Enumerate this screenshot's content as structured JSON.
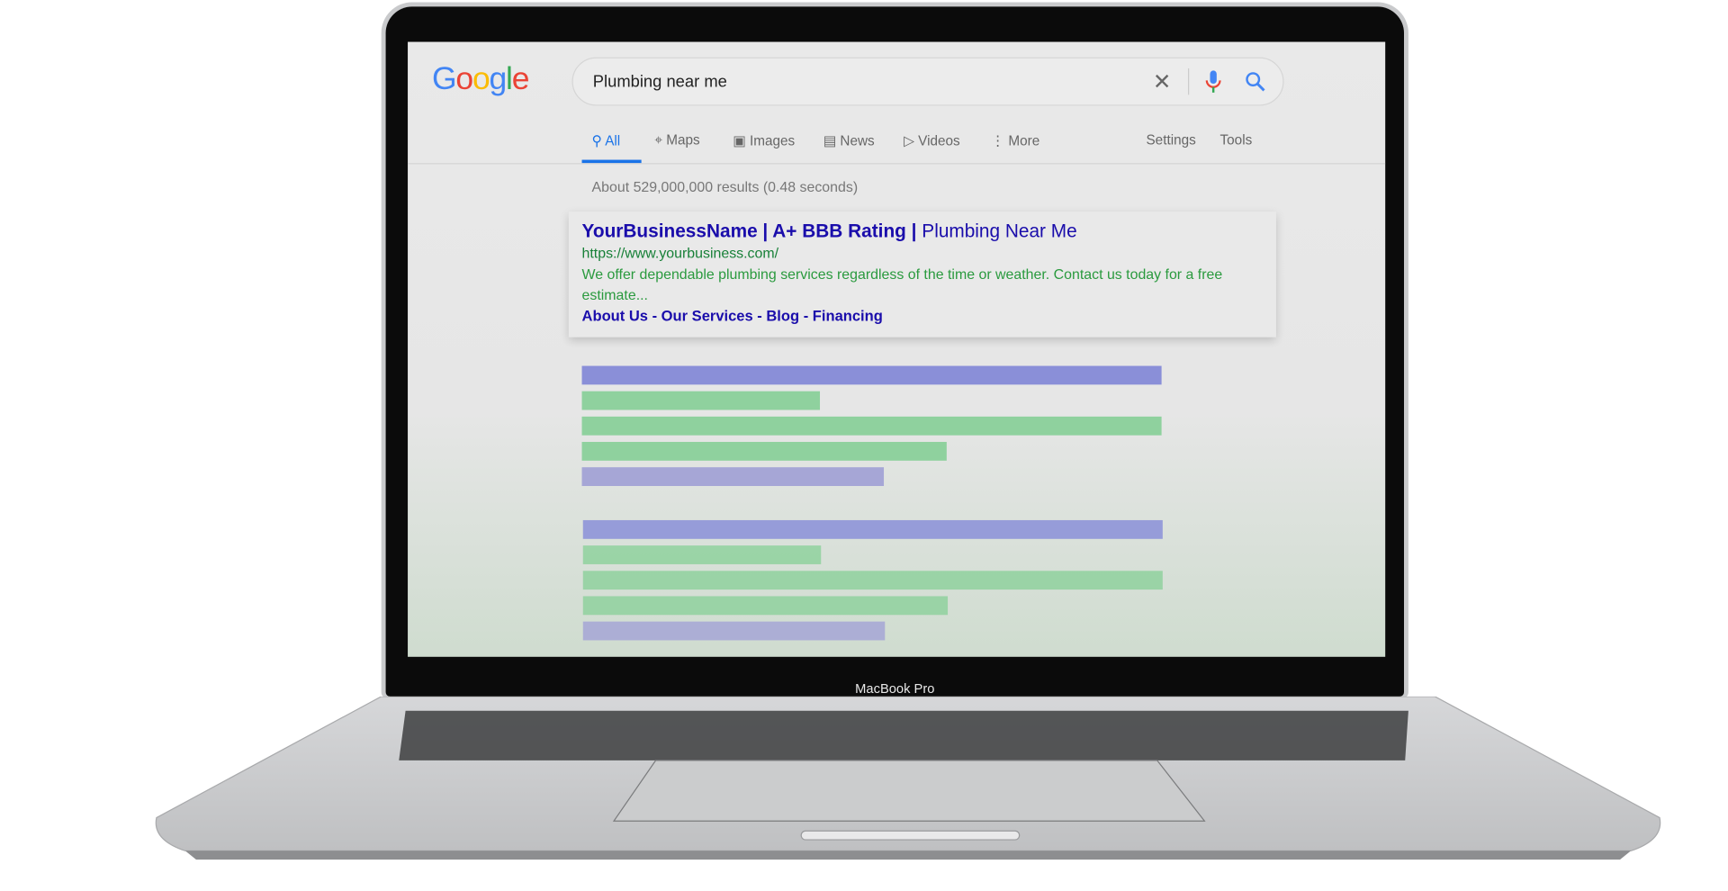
{
  "device": {
    "label": "MacBook Pro"
  },
  "google": {
    "logo": "Google",
    "search_query": "Plumbing near me",
    "icons": {
      "clear": "close-icon",
      "voice": "microphone-icon",
      "search": "search-icon"
    },
    "tabs": [
      {
        "label": "All",
        "icon": "search-icon",
        "active": true
      },
      {
        "label": "Maps",
        "icon": "map-pin-icon"
      },
      {
        "label": "Images",
        "icon": "image-icon"
      },
      {
        "label": "News",
        "icon": "news-icon"
      },
      {
        "label": "Videos",
        "icon": "play-icon"
      },
      {
        "label": "More",
        "icon": "more-vertical-icon"
      }
    ],
    "settings": "Settings",
    "tools": "Tools",
    "stats": "About 529,000,000 results (0.48 seconds)",
    "result": {
      "title": "YourBusinessName | A+ BBB Rating |",
      "title_tail": "Plumbing Near Me",
      "url": "https://www.yourbusiness.com/",
      "description": "We offer dependable plumbing services regardless of the time or weather. Contact us today for a free estimate...",
      "sitelinks": "About Us - Our Services - Blog - Financing"
    },
    "colors": {
      "link": "#1a0dab",
      "green": "#188038",
      "accent": "#1a73e8",
      "placeholder_purple": "#8a8fd8",
      "placeholder_green": "#8fd19e"
    }
  }
}
